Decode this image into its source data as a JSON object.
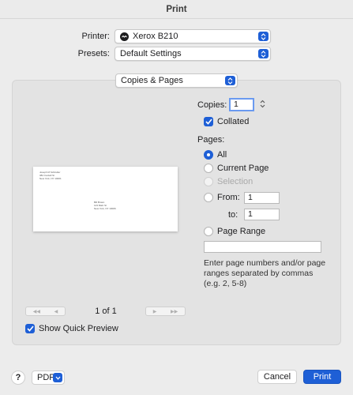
{
  "window": {
    "title": "Print"
  },
  "printer": {
    "label": "Printer:",
    "value": "Xerox B210"
  },
  "presets": {
    "label": "Presets:",
    "value": "Default Settings"
  },
  "section": {
    "value": "Copies & Pages"
  },
  "copies": {
    "label": "Copies:",
    "value": "1",
    "collated_label": "Collated",
    "collated": true
  },
  "pages": {
    "label": "Pages:",
    "options": {
      "all": "All",
      "current": "Current Page",
      "selection": "Selection",
      "from": "From:",
      "to": "to:",
      "range": "Page Range"
    },
    "selected": "all",
    "from_value": "1",
    "to_value": "1",
    "range_value": "",
    "help": "Enter page numbers and/or page ranges separated by commas (e.g. 2, 5-8)"
  },
  "preview": {
    "page_indicator": "1 of 1",
    "show_quick_preview_label": "Show Quick Preview",
    "show_quick_preview": true
  },
  "bottom": {
    "help": "?",
    "pdf": "PDF",
    "cancel": "Cancel",
    "print": "Print"
  },
  "colors": {
    "accent": "#1e5fd6",
    "panel": "#e3e3e3",
    "window": "#ececec"
  }
}
